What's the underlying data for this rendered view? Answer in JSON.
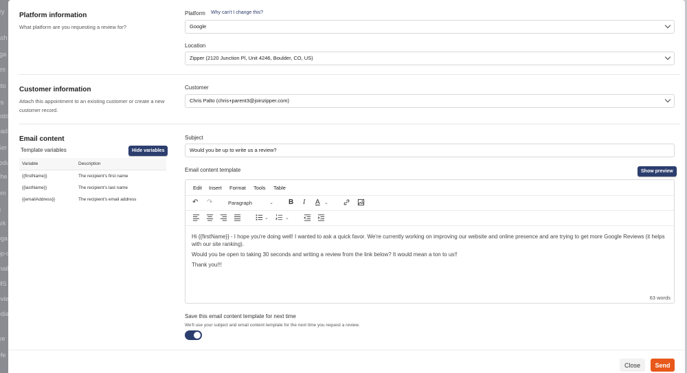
{
  "backdrop": {
    "items": [
      "rry",
      "ash",
      "rga",
      "tes",
      "uto",
      "es",
      "usto",
      "ead",
      "Ser",
      "rodu",
      "che",
      "om",
      "g",
      "ark",
      "oga",
      "pp-c",
      "mail",
      "MS",
      "evie",
      "edia",
      "ive",
      "efe"
    ]
  },
  "platform": {
    "title": "Platform information",
    "description": "What platform are you requesting a review for?",
    "platform_label": "Platform",
    "help_link": "Why can't I change this?",
    "platform_value": "Google",
    "location_label": "Location",
    "location_value": "Zipper (2120 Junction Pl, Unit 4246, Boulder, CO, US)"
  },
  "customer": {
    "title": "Customer information",
    "description": "Attach this appointment to an existing customer or create a new customer record.",
    "label": "Customer",
    "value": "Chris Palto (chris+parent3@joinzipper.com)"
  },
  "email": {
    "title": "Email content",
    "variables_title": "Template variables",
    "hide_variables": "Hide variables",
    "col_variable": "Variable",
    "col_description": "Description",
    "variables": [
      {
        "name": "{{firstName}}",
        "desc": "The recipient's first name"
      },
      {
        "name": "{{lastName}}",
        "desc": "The recipient's last name"
      },
      {
        "name": "{{emailAddress}}",
        "desc": "The recipient's email address"
      }
    ],
    "subject_label": "Subject",
    "subject_value": "Would you be up to write us a review?",
    "template_label": "Email content template",
    "show_preview": "Show preview"
  },
  "editor": {
    "menu": [
      "Edit",
      "Insert",
      "Format",
      "Tools",
      "Table"
    ],
    "paragraph": "Paragraph",
    "paragraphs": [
      "Hi {{firstName}} - I hope you're doing well! I wanted to ask a quick favor. We're currently working on improving our website and online presence and are trying to get more Google Reviews (it helps with our site ranking).",
      "Would you be open to taking 30 seconds and writing a review from the link below? It would mean a ton to us!!",
      "Thank you!!!"
    ],
    "word_count": "63 words"
  },
  "save": {
    "title": "Save this email content template for next time",
    "description": "We'll use your subject and email content template for the next time you request a review.",
    "enabled": true
  },
  "footer": {
    "close": "Close",
    "send": "Send"
  },
  "colors": {
    "primary": "#2c3e6e",
    "send": "#e8581a"
  }
}
